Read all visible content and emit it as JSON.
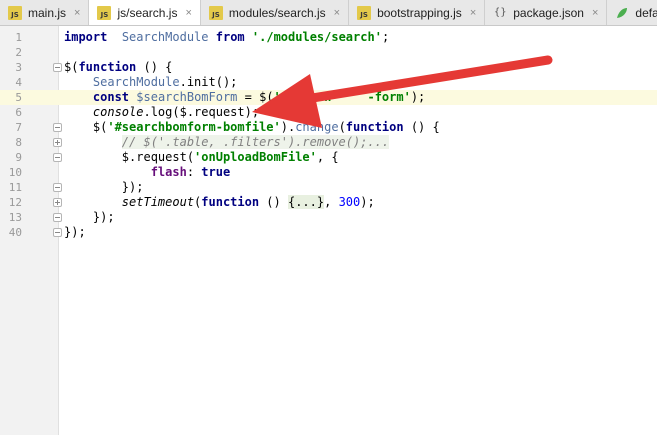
{
  "tabs": [
    {
      "label": "main.js",
      "icon": "js-file-icon"
    },
    {
      "label": "js/search.js",
      "icon": "js-file-icon",
      "active": true
    },
    {
      "label": "modules/search.js",
      "icon": "js-file-icon"
    },
    {
      "label": "bootstrapping.js",
      "icon": "js-file-icon"
    },
    {
      "label": "package.json",
      "icon": "json-file-icon"
    },
    {
      "label": "defaul",
      "icon": "leaf-icon"
    }
  ],
  "tab_close_glyph": "×",
  "file_icon_text": "JS",
  "json_icon_text": "{}",
  "lines": [
    {
      "no": "1",
      "segs": [
        [
          "kw",
          "import"
        ],
        [
          "",
          "  "
        ],
        [
          "id",
          "SearchModule"
        ],
        [
          "",
          " "
        ],
        [
          "kw",
          "from"
        ],
        [
          "",
          " "
        ],
        [
          "str",
          "'./modules/search'"
        ],
        [
          "",
          ";"
        ]
      ]
    },
    {
      "no": "2",
      "segs": []
    },
    {
      "no": "3",
      "segs": [
        [
          "",
          "$("
        ],
        [
          "kw",
          "function"
        ],
        [
          "",
          " () {"
        ]
      ]
    },
    {
      "no": "4",
      "segs": [
        [
          "",
          "    "
        ],
        [
          "id",
          "SearchModule"
        ],
        [
          "",
          ".init();"
        ]
      ]
    },
    {
      "no": "5",
      "segs": [
        [
          "",
          "    "
        ],
        [
          "kw",
          "const"
        ],
        [
          "",
          " "
        ],
        [
          "id",
          "$searchBomForm"
        ],
        [
          "",
          " = $("
        ],
        [
          "str",
          "'#search"
        ],
        [
          "",
          "     "
        ],
        [
          "str",
          "-form'"
        ],
        [
          "",
          ");"
        ]
      ]
    },
    {
      "no": "6",
      "segs": [
        [
          "",
          "    "
        ],
        [
          "it",
          "console"
        ],
        [
          "",
          ".log($.request);"
        ]
      ]
    },
    {
      "no": "7",
      "segs": [
        [
          "",
          "    $("
        ],
        [
          "str",
          "'#searchbomform-bomfile'"
        ],
        [
          "",
          ")."
        ],
        [
          "id",
          "change"
        ],
        [
          "",
          "("
        ],
        [
          "kw",
          "function"
        ],
        [
          "",
          " () {"
        ]
      ]
    },
    {
      "no": "8",
      "segs": [
        [
          "",
          "        "
        ],
        [
          "cmt",
          "// $('.table, .filters').remove();..."
        ]
      ]
    },
    {
      "no": "9",
      "segs": [
        [
          "",
          "        $.request("
        ],
        [
          "str",
          "'onUploadBomFile'"
        ],
        [
          "",
          ", {"
        ]
      ]
    },
    {
      "no": "10",
      "segs": [
        [
          "",
          "            "
        ],
        [
          "prop",
          "flash"
        ],
        [
          "",
          ": "
        ],
        [
          "kw",
          "true"
        ]
      ]
    },
    {
      "no": "11",
      "segs": [
        [
          "",
          "        });"
        ]
      ]
    },
    {
      "no": "12",
      "segs": [
        [
          "",
          "        "
        ],
        [
          "it",
          "setTimeout"
        ],
        [
          "",
          "("
        ],
        [
          "kw",
          "function"
        ],
        [
          "",
          " () "
        ],
        [
          "fold-ph",
          "{...}"
        ],
        [
          "",
          ", "
        ],
        [
          "num",
          "300"
        ],
        [
          "",
          ");"
        ]
      ]
    },
    {
      "no": "13",
      "segs": [
        [
          "",
          "    });"
        ]
      ]
    },
    {
      "no": "40",
      "segs": [
        [
          "",
          "});"
        ]
      ]
    }
  ],
  "current_line": 5,
  "annotation": {
    "color": "#e53935"
  }
}
